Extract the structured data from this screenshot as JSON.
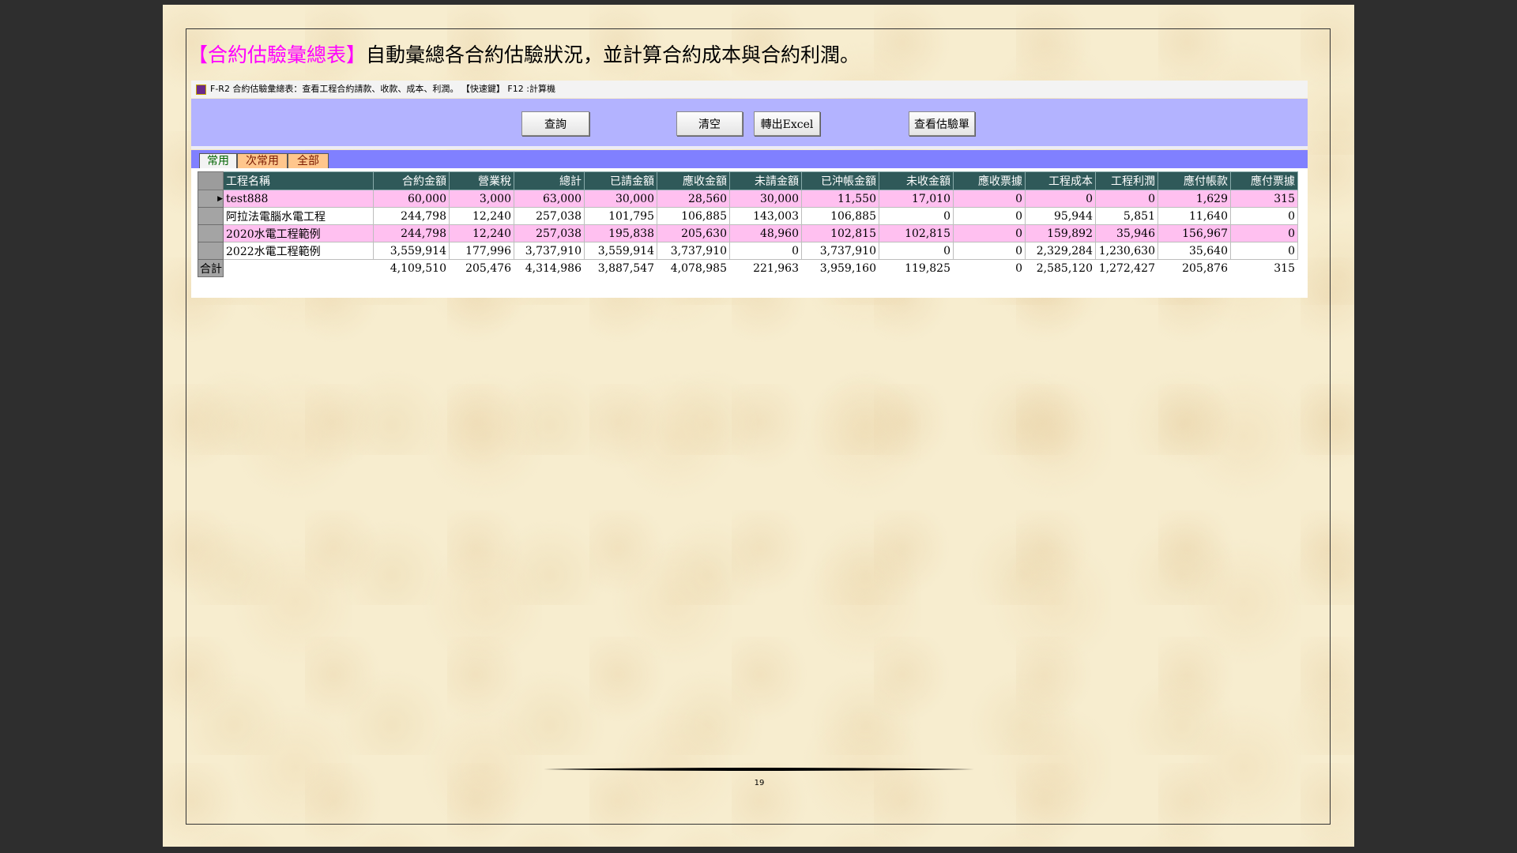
{
  "heading": {
    "highlight": "【合約估驗彙總表】",
    "rest": "自動彙總各合約估驗狀況，並計算合約成本與合約利潤。"
  },
  "window": {
    "title": "F-R2 合約估驗彙總表：查看工程合約請款、收款、成本、利潤。  【快速鍵】 F12 :計算機"
  },
  "toolbar": {
    "query": "查詢",
    "clear": "清空",
    "export": "轉出Excel",
    "view": "查看估驗單"
  },
  "tabs": [
    "常用",
    "次常用",
    "全部"
  ],
  "table": {
    "headers": [
      "工程名稱",
      "合約金額",
      "營業稅",
      "總計",
      "已請金額",
      "應收金額",
      "未請金額",
      "已沖帳金額",
      "未收金額",
      "應收票據",
      "工程成本",
      "工程利潤",
      "應付帳款",
      "應付票據"
    ],
    "rows": [
      [
        "test888",
        "60,000",
        "3,000",
        "63,000",
        "30,000",
        "28,560",
        "30,000",
        "11,550",
        "17,010",
        "0",
        "0",
        "0",
        "1,629",
        "315"
      ],
      [
        "阿拉法電腦水電工程",
        "244,798",
        "12,240",
        "257,038",
        "101,795",
        "106,885",
        "143,003",
        "106,885",
        "0",
        "0",
        "95,944",
        "5,851",
        "11,640",
        "0"
      ],
      [
        "2020水電工程範例",
        "244,798",
        "12,240",
        "257,038",
        "195,838",
        "205,630",
        "48,960",
        "102,815",
        "102,815",
        "0",
        "159,892",
        "35,946",
        "156,967",
        "0"
      ],
      [
        "2022水電工程範例",
        "3,559,914",
        "177,996",
        "3,737,910",
        "3,559,914",
        "3,737,910",
        "0",
        "3,737,910",
        "0",
        "0",
        "2,329,284",
        "1,230,630",
        "35,640",
        "0"
      ]
    ],
    "total_label": "合計",
    "totals": [
      "",
      "4,109,510",
      "205,476",
      "4,314,986",
      "3,887,547",
      "4,078,985",
      "221,963",
      "3,959,160",
      "119,825",
      "0",
      "2,585,120",
      "1,272,427",
      "205,876",
      "315"
    ]
  },
  "page_number": "19"
}
